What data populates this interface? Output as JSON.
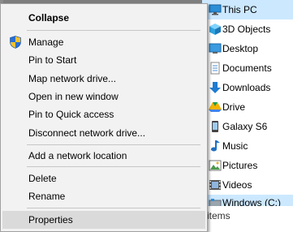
{
  "context_menu": {
    "items": [
      {
        "label": "Collapse",
        "bold": true
      },
      {
        "label": "Manage",
        "icon": "shield-icon"
      },
      {
        "label": "Pin to Start"
      },
      {
        "label": "Map network drive..."
      },
      {
        "label": "Open in new window"
      },
      {
        "label": "Pin to Quick access"
      },
      {
        "label": "Disconnect network drive..."
      },
      {
        "label": "Add a network location"
      },
      {
        "label": "Delete"
      },
      {
        "label": "Rename"
      },
      {
        "label": "Properties",
        "highlighted": true
      }
    ]
  },
  "nav_pane": {
    "items": [
      {
        "label": "This PC",
        "icon": "computer-icon",
        "selected": true
      },
      {
        "label": "3D Objects",
        "icon": "cube-icon"
      },
      {
        "label": "Desktop",
        "icon": "desktop-icon"
      },
      {
        "label": "Documents",
        "icon": "documents-icon"
      },
      {
        "label": "Downloads",
        "icon": "download-arrow-icon"
      },
      {
        "label": "Drive",
        "icon": "drive-icon"
      },
      {
        "label": "Galaxy S6",
        "icon": "phone-icon"
      },
      {
        "label": "Music",
        "icon": "music-note-icon"
      },
      {
        "label": "Pictures",
        "icon": "pictures-icon"
      },
      {
        "label": "Videos",
        "icon": "film-icon"
      },
      {
        "label": "Windows (C:)",
        "icon": "disk-icon"
      }
    ]
  },
  "status_bar": {
    "text": "items"
  },
  "colors": {
    "menu_bg": "#f2f2f2",
    "highlight": "#dadada",
    "nav_selected": "#cce8ff"
  }
}
